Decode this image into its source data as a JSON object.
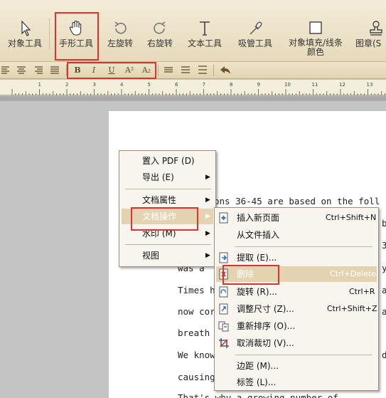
{
  "toolbar": {
    "tools": [
      {
        "label": "对象工具",
        "icon": "cursor-icon"
      },
      {
        "label": "手形工具",
        "icon": "hand-icon"
      },
      {
        "label": "左旋转",
        "icon": "rotate-left-icon"
      },
      {
        "label": "右旋转",
        "icon": "rotate-right-icon"
      },
      {
        "label": "文本工具",
        "icon": "text-tool-icon"
      },
      {
        "label": "吸管工具",
        "icon": "eyedropper-icon"
      },
      {
        "label_line1": "对象填充/线条",
        "label_line2": "颜色",
        "icon": "fill-color-icon"
      },
      {
        "label": "图章(S",
        "icon": "stamp-icon"
      }
    ]
  },
  "format_bar": {
    "bold": "B",
    "italic": "I",
    "underline": "U",
    "superscript": "A²",
    "subscript": "A₂"
  },
  "ruler": {
    "numbers": [
      "1",
      "2",
      "3",
      "4",
      "5",
      "6",
      "7",
      "8",
      "9",
      "10",
      "11",
      "12",
      "13"
    ]
  },
  "document": {
    "lines": [
      "ons 36-45 are based on the foll",
      "was a",
      "Times h",
      "now cor",
      " breath",
      "We know",
      "causing",
      "That's why a growing number of"
    ],
    "fragments": {
      "right_a": "a",
      "right_3": "3",
      "right_y": "y",
      "right_b": "b",
      "right_d": "d"
    }
  },
  "main_menu": {
    "items": [
      {
        "label": "置入 PDF (D)",
        "submenu": false
      },
      {
        "label": "导出 (E)",
        "submenu": true
      },
      {
        "label": "文档属性",
        "submenu": true
      },
      {
        "label": "文档操作",
        "submenu": true
      },
      {
        "label": "水印 (M)",
        "submenu": true
      },
      {
        "label": "视图",
        "submenu": true
      }
    ],
    "selected": "文档操作"
  },
  "submenu": {
    "items": [
      {
        "label": "插入新页面",
        "shortcut": "Ctrl+Shift+N",
        "icon": "insert-page-icon"
      },
      {
        "label": "从文件插入",
        "shortcut": "",
        "icon": ""
      },
      {
        "label": "提取 (E)...",
        "shortcut": "",
        "icon": "extract-icon"
      },
      {
        "label": "删除",
        "shortcut": "Ctrl+Delete",
        "icon": "delete-page-icon"
      },
      {
        "label": "旋转 (R)...",
        "shortcut": "Ctrl+R",
        "icon": "rotate-page-icon"
      },
      {
        "label": "调整尺寸 (Z)...",
        "shortcut": "Ctrl+Shift+Z",
        "icon": "resize-icon"
      },
      {
        "label": "重新排序 (O)...",
        "shortcut": "",
        "icon": "reorder-icon"
      },
      {
        "label": "取消裁切 (V)...",
        "shortcut": "",
        "icon": "uncrop-icon"
      },
      {
        "label": "边距 (M)...",
        "shortcut": "",
        "icon": ""
      },
      {
        "label": "标签 (L)...",
        "shortcut": "",
        "icon": ""
      }
    ],
    "selected": "删除"
  },
  "colors": {
    "highlight_red": "#e0312d",
    "menu_selected": "#e4d3b1",
    "toolbar_bg": "#efe5cc"
  }
}
